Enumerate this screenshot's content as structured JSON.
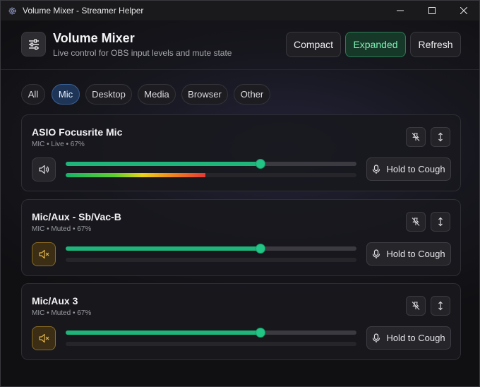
{
  "window": {
    "title": "Volume Mixer - Streamer Helper"
  },
  "header": {
    "title": "Volume Mixer",
    "subtitle": "Live control for OBS input levels and mute state",
    "buttons": [
      {
        "label": "Compact",
        "active": false
      },
      {
        "label": "Expanded",
        "active": true
      },
      {
        "label": "Refresh",
        "active": false
      }
    ]
  },
  "filters": [
    {
      "label": "All",
      "active": false
    },
    {
      "label": "Mic",
      "active": true
    },
    {
      "label": "Desktop",
      "active": false
    },
    {
      "label": "Media",
      "active": false
    },
    {
      "label": "Browser",
      "active": false
    },
    {
      "label": "Other",
      "active": false
    }
  ],
  "sources": [
    {
      "name": "ASIO Focusrite Mic",
      "meta": "MIC • Live • 67%",
      "muted": false,
      "volume": 0.67,
      "level": 0.48,
      "cough_label": "Hold to Cough",
      "speaker_icon": "speaker-icon"
    },
    {
      "name": "Mic/Aux - Sb/Vac-B",
      "meta": "MIC • Muted • 67%",
      "muted": true,
      "volume": 0.67,
      "level": 0,
      "cough_label": "Hold to Cough",
      "speaker_icon": "speaker-muted-icon"
    },
    {
      "name": "Mic/Aux 3",
      "meta": "MIC • Muted • 67%",
      "muted": true,
      "volume": 0.67,
      "level": 0,
      "cough_label": "Hold to Cough",
      "speaker_icon": "speaker-muted-icon"
    }
  ],
  "colors": {
    "accent": "#1fb47a",
    "active_filter": "#1e3557",
    "muted_button": "#3b2e14",
    "muted_icon": "#e0b24a"
  }
}
